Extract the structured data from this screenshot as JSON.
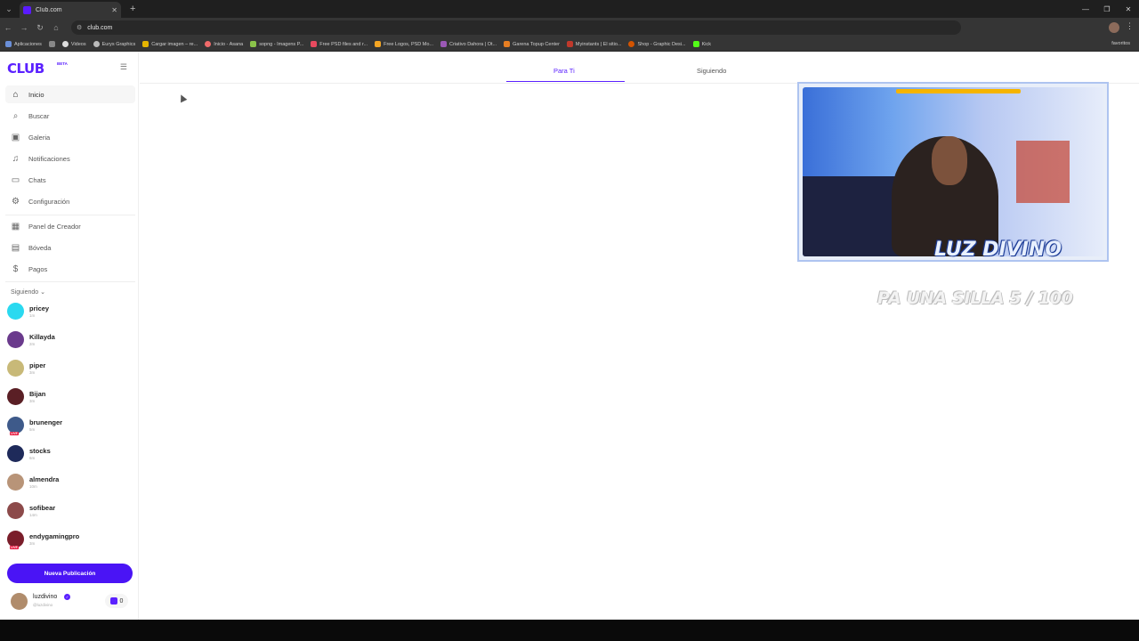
{
  "browser": {
    "tab_title": "Club.com",
    "url": "club.com",
    "bookmarks": [
      "Aplicaciones",
      "Videos",
      "Eurys Graphics",
      "Cargar imagen – re...",
      "Inicio - Asana",
      "sopng - Imagens P...",
      "Free PSD files and r...",
      "Free Logos, PSD Mo...",
      "Criativo Dahora | Ot...",
      "Garena Topup Center",
      "Myinstants | El sitio...",
      "Shop - Graphic Desi...",
      "Kick"
    ],
    "bookmarks_all": "favoritos"
  },
  "sidebar": {
    "logo": "CLUB",
    "beta": "BETA",
    "nav": [
      {
        "label": "Inicio",
        "icon": "home-icon"
      },
      {
        "label": "Buscar",
        "icon": "search-icon"
      },
      {
        "label": "Galeria",
        "icon": "gallery-icon"
      },
      {
        "label": "Notificaciones",
        "icon": "bell-icon"
      },
      {
        "label": "Chats",
        "icon": "chat-icon"
      },
      {
        "label": "Configuración",
        "icon": "gear-icon"
      }
    ],
    "creator_nav": [
      {
        "label": "Panel de Creador",
        "icon": "dashboard-icon"
      },
      {
        "label": "Bóveda",
        "icon": "vault-icon"
      },
      {
        "label": "Pagos",
        "icon": "dollar-icon"
      }
    ],
    "following_title": "Siguiendo",
    "following": [
      {
        "name": "pricey",
        "time": "1m",
        "color": "#2ad9f0",
        "live": false
      },
      {
        "name": "Killayda",
        "time": "2m",
        "color": "#6a3a8c",
        "live": false
      },
      {
        "name": "piper",
        "time": "3m",
        "color": "#c8b978",
        "live": false
      },
      {
        "name": "Bijan",
        "time": "3m",
        "color": "#5a1f25",
        "live": false
      },
      {
        "name": "brunenger",
        "time": "5m",
        "color": "#3e5a8a",
        "live": true
      },
      {
        "name": "stocks",
        "time": "6m",
        "color": "#1e2a5a",
        "live": false
      },
      {
        "name": "almendra",
        "time": "10m",
        "color": "#b89478",
        "live": false
      },
      {
        "name": "sofibear",
        "time": "14m",
        "color": "#8c4a4a",
        "live": false
      },
      {
        "name": "endygamingpro",
        "time": "3m",
        "color": "#7a1d2a",
        "live": true
      }
    ],
    "live_badge": "LIVE",
    "new_post": "Nueva Publicación",
    "me": {
      "name": "luzdivino",
      "handle": "@luzdivino",
      "coins": "0"
    }
  },
  "main": {
    "tabs": [
      "Para Ti",
      "Siguiendo"
    ]
  },
  "overlay": {
    "logo": "LUZ DIVINO",
    "goal": "PA UNA SILLA 5 / 100"
  },
  "colors": {
    "accent": "#5b21ff",
    "button": "#4a14f5"
  }
}
